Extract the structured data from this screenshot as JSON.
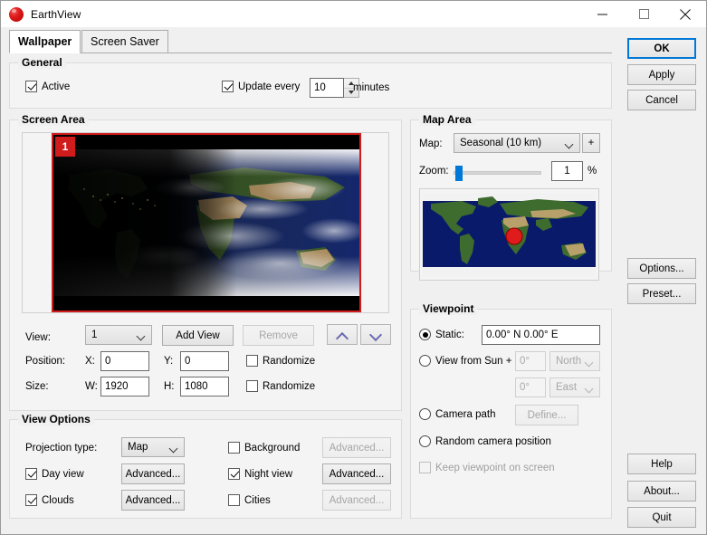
{
  "window": {
    "title": "EarthView",
    "icon": "earth-globe-icon",
    "controls": {
      "minimize": "minimize-icon",
      "maximize": "maximize-icon",
      "close": "close-icon"
    }
  },
  "tabs": [
    {
      "label": "Wallpaper",
      "active": true
    },
    {
      "label": "Screen Saver",
      "active": false
    }
  ],
  "general": {
    "title": "General",
    "active": {
      "label": "Active",
      "checked": true
    },
    "update_every": {
      "label": "Update every",
      "checked": true
    },
    "interval_value": "10",
    "interval_unit": "minutes"
  },
  "screen_area": {
    "title": "Screen Area",
    "view_badge": "1",
    "view_label": "View:",
    "view_value": "1",
    "add_view_button": "Add View",
    "remove_button": "Remove",
    "move_up_icon": "chevron-up-icon",
    "move_down_icon": "chevron-down-icon",
    "position_label": "Position:",
    "x_label": "X:",
    "x_value": "0",
    "y_label": "Y:",
    "y_value": "0",
    "position_randomize": {
      "label": "Randomize",
      "checked": false
    },
    "size_label": "Size:",
    "w_label": "W:",
    "w_value": "1920",
    "h_label": "H:",
    "h_value": "1080",
    "size_randomize": {
      "label": "Randomize",
      "checked": false
    }
  },
  "view_options": {
    "title": "View Options",
    "projection_label": "Projection type:",
    "projection_value": "Map",
    "day_view": {
      "label": "Day view",
      "checked": true
    },
    "day_advanced": "Advanced...",
    "clouds": {
      "label": "Clouds",
      "checked": true
    },
    "clouds_advanced": "Advanced...",
    "background": {
      "label": "Background",
      "checked": false
    },
    "background_advanced": "Advanced...",
    "night_view": {
      "label": "Night view",
      "checked": true
    },
    "night_advanced": "Advanced...",
    "cities": {
      "label": "Cities",
      "checked": false
    },
    "cities_advanced": "Advanced..."
  },
  "map_area": {
    "title": "Map Area",
    "map_label": "Map:",
    "map_value": "Seasonal (10 km)",
    "add_map_button": "+",
    "zoom_label": "Zoom:",
    "zoom_value": "1",
    "zoom_unit": "%",
    "zoom_percent": 1
  },
  "viewpoint": {
    "title": "Viewpoint",
    "static": {
      "label": "Static:",
      "selected": true
    },
    "static_value": "0.00° N   0.00° E",
    "view_from_sun": {
      "label": "View from Sun +",
      "selected": false
    },
    "sun_offset_lat": "0°",
    "sun_dir_lat": "North",
    "sun_offset_lon": "0°",
    "sun_dir_lon": "East",
    "camera_path": {
      "label": "Camera path",
      "selected": false
    },
    "define_button": "Define...",
    "random_camera": {
      "label": "Random camera position",
      "selected": false
    },
    "keep_on_screen": {
      "label": "Keep viewpoint on screen",
      "checked": false
    }
  },
  "side_buttons": {
    "ok": "OK",
    "apply": "Apply",
    "cancel": "Cancel",
    "options": "Options...",
    "preset": "Preset...",
    "help": "Help",
    "about": "About...",
    "quit": "Quit"
  },
  "colors": {
    "accent": "#0078d7",
    "marker": "#d01c1c",
    "window_bg": "#f0f0f0",
    "group_bg": "#f4f4f4"
  }
}
